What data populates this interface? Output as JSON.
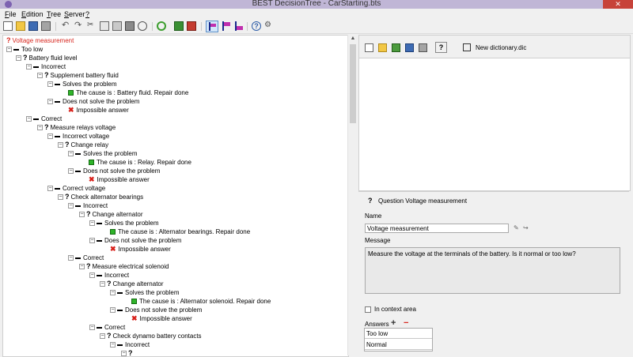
{
  "window": {
    "title": "BEST DecisionTree - CarStarting.bts",
    "close": "✕"
  },
  "menu": [
    {
      "label": "File",
      "ul": "F",
      "rest": "ile"
    },
    {
      "label": "Edition",
      "ul": "E",
      "rest": "dition"
    },
    {
      "label": "Tree",
      "ul": "T",
      "rest": "ree"
    },
    {
      "label": "Server",
      "ul": "S",
      "rest": "erver"
    },
    {
      "label": "?",
      "ul": "?",
      "rest": ""
    }
  ],
  "tree": {
    "root": "Voltage measurement",
    "n1": "Too low",
    "n2": "Battery fluid level",
    "n3": "Incorrect",
    "n4": "Supplement battery fluid",
    "n5": "Solves the problem",
    "n6": "The cause is : Battery fluid. Repair done",
    "n7": "Does not solve the problem",
    "n8": "Impossible answer",
    "n9": "Correct",
    "n10": "Measure relays voltage",
    "n11": "Incorrect voltage",
    "n12": "Change relay",
    "n13": "Solves the problem",
    "n14": "The cause is : Relay. Repair done",
    "n15": "Does not solve the problem",
    "n16": "Impossible answer",
    "n17": "Correct voltage",
    "n18": "Check alternator bearings",
    "n19": "Incorrect",
    "n20": "Change alternator",
    "n21": "Solves the problem",
    "n22": "The cause is : Alternator bearings. Repair done",
    "n23": "Does not solve the problem",
    "n24": "Impossible answer",
    "n25": "Correct",
    "n26": "Measure electrical solenoid",
    "n27": "Incorrect",
    "n28": "Change alternator",
    "n29": "Solves the problem",
    "n30": "The cause is : Alternator solenoid. Repair done",
    "n31": "Does not solve the problem",
    "n32": "Impossible answer",
    "n33": "Correct",
    "n34": "Check dynamo battery contacts",
    "n35": "Incorrect"
  },
  "dictionary": {
    "label": "New dictionary.dic"
  },
  "details": {
    "header": "Question Voltage measurement",
    "name_label": "Name",
    "name_value": "Voltage measurement",
    "message_label": "Message",
    "message_value": "Measure the voltage at the terminals of the battery. Is it normal or too low?",
    "context_label": "In context area",
    "answers_label": "Answers",
    "answers": [
      "Too low",
      "Normal"
    ]
  },
  "colors": {
    "accent_red": "#d7261e",
    "leaf_green": "#2fb42a",
    "titlebar": "#c0b6d6",
    "close_red": "#c7433a"
  }
}
